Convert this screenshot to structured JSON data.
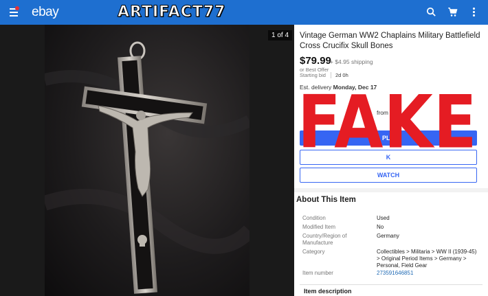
{
  "header": {
    "logo": "ebay",
    "watermark": "ARTIFACT77",
    "icons": [
      "menu-icon",
      "search-icon",
      "cart-icon",
      "more-icon"
    ]
  },
  "gallery": {
    "counter": "1 of 4"
  },
  "listing": {
    "title": "Vintage German WW2 Chaplains Military Battlefield Cross Crucifix Skull Bones",
    "price": "$79.99",
    "shipping": "+ $4.95 shipping",
    "best_offer": "or Best Offer",
    "starting_bid_label": "Starting bid",
    "time_left": "2d 0h",
    "delivery_label": "Est. delivery",
    "delivery_date": "Monday, Dec 17",
    "seller_partial": "from",
    "buttons": {
      "primary": "PLA",
      "secondary": "K",
      "watch": "WATCH"
    },
    "stamp": "FAKE"
  },
  "about": {
    "heading": "About This Item",
    "rows": [
      {
        "label": "Condition",
        "value": "Used"
      },
      {
        "label": "Modified Item",
        "value": "No"
      },
      {
        "label": "Country/Region of Manufacture",
        "value": "Germany"
      },
      {
        "label": "Category",
        "value": "Collectibles > Militaria > WW II (1939-45) > Original Period Items > Germany > Personal, Field Gear"
      },
      {
        "label": "Item number",
        "value": "273591646851"
      }
    ],
    "description_heading": "Item description"
  },
  "colors": {
    "topbar": "#1e6fd0",
    "accent": "#3665f3",
    "stamp": "#e51c23",
    "link": "#1f6ab5"
  }
}
